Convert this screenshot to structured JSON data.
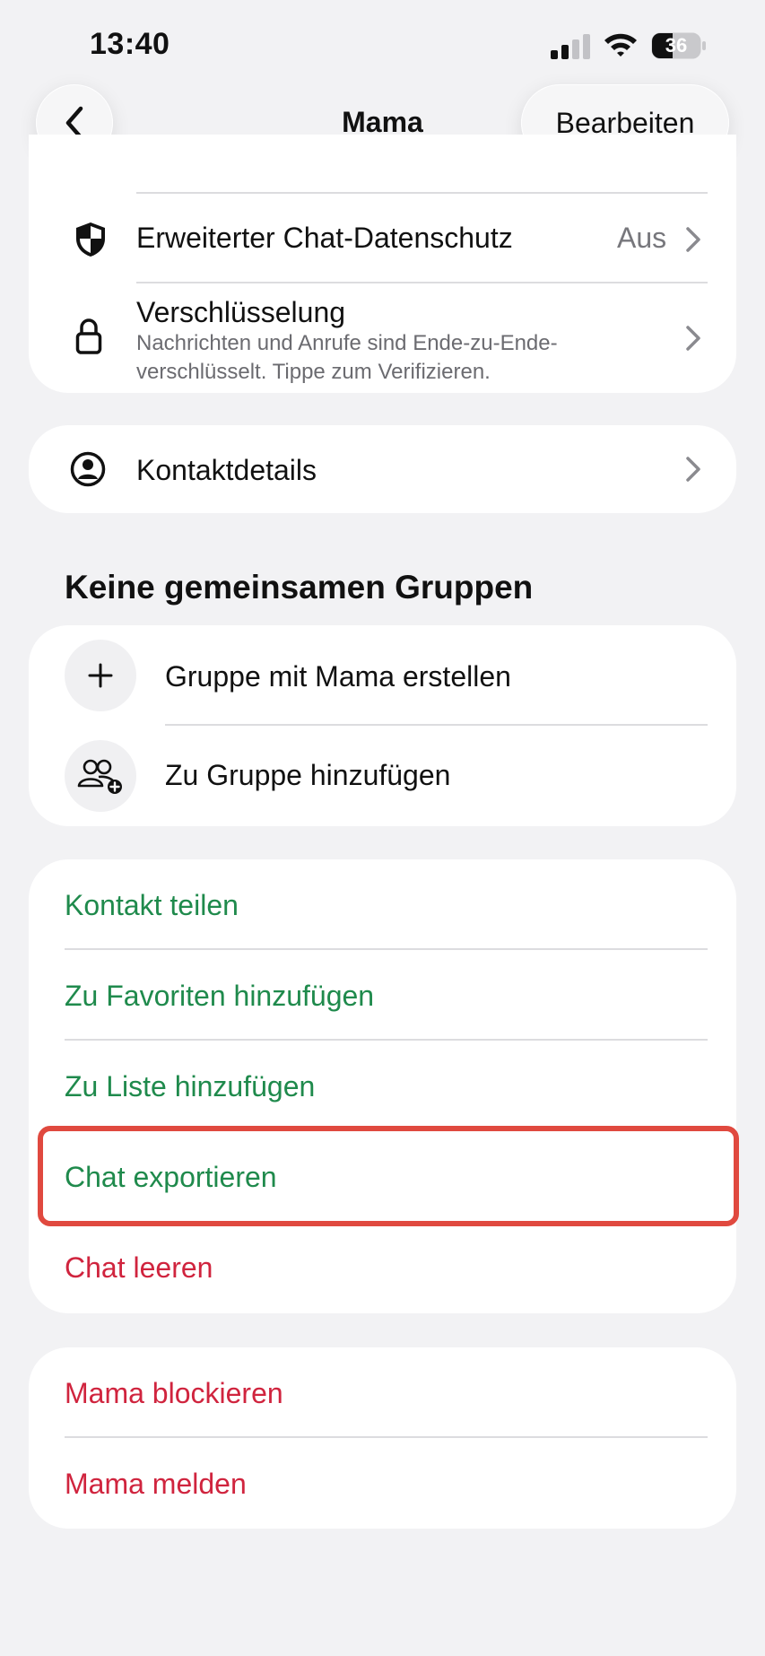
{
  "status_bar": {
    "time": "13:40",
    "battery": "36"
  },
  "header": {
    "title": "Mama",
    "edit_label": "Bearbeiten"
  },
  "privacy": {
    "advanced_privacy_label": "Erweiterter Chat-Datenschutz",
    "advanced_privacy_value": "Aus",
    "encryption_label": "Verschlüsselung",
    "encryption_sub": "Nachrichten und Anrufe sind Ende-zu-Ende-verschlüsselt. Tippe zum Verifizieren."
  },
  "contact": {
    "details_label": "Kontaktdetails"
  },
  "groups": {
    "heading": "Keine gemeinsamen Gruppen",
    "create_label": "Gruppe mit Mama erstellen",
    "add_label": "Zu Gruppe hinzufügen"
  },
  "actions": {
    "share_contact": "Kontakt teilen",
    "add_favorites": "Zu Favoriten hinzufügen",
    "add_list": "Zu Liste hinzufügen",
    "export_chat": "Chat exportieren",
    "clear_chat": "Chat leeren"
  },
  "danger": {
    "block": "Mama blockieren",
    "report": "Mama melden"
  },
  "colors": {
    "green": "#1f8a4c",
    "red": "#d0243e",
    "highlight": "#e0493f",
    "background": "#f2f2f4"
  }
}
